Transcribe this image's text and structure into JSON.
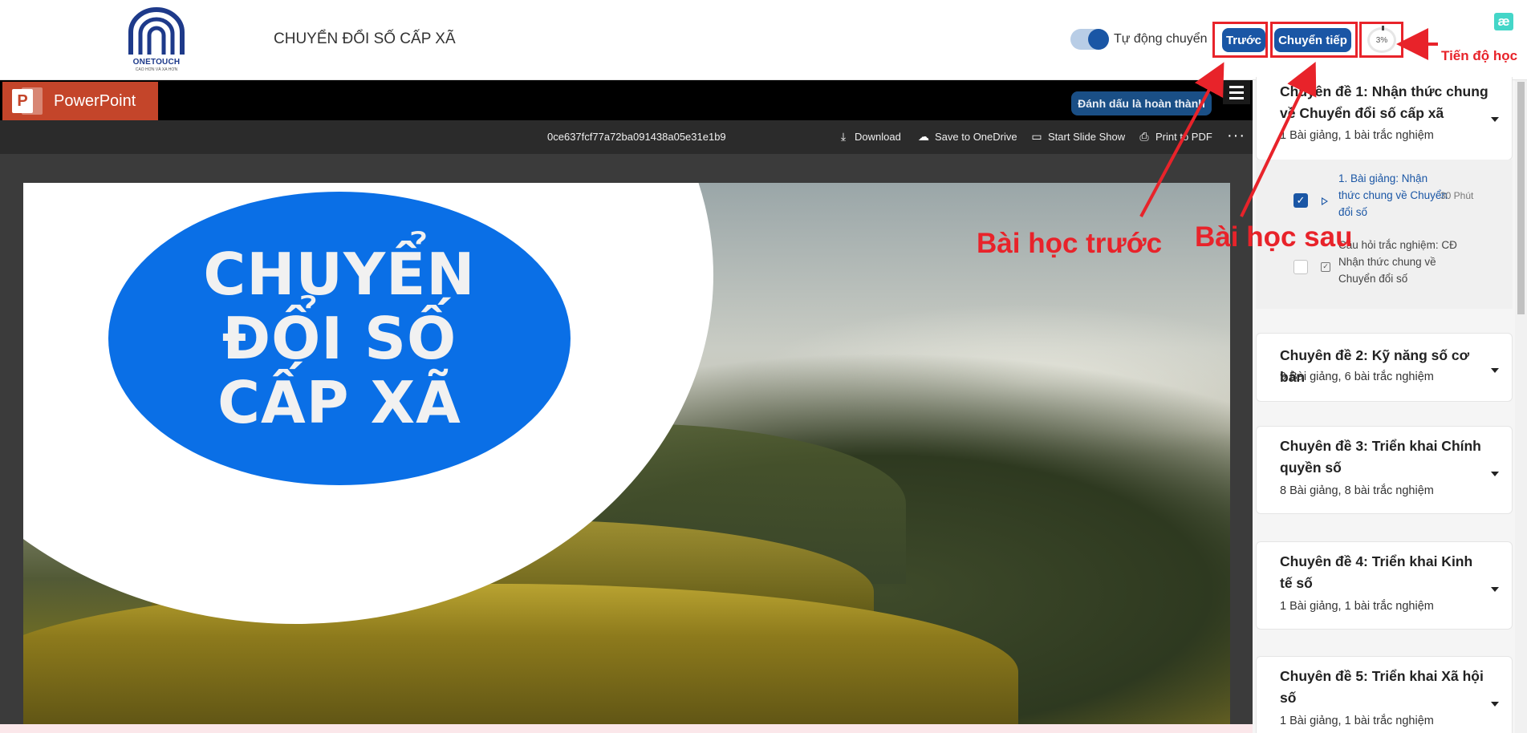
{
  "header": {
    "logo_brand": "ONETOUCH",
    "logo_tagline": "CAO HƠN VÀ XA HƠN",
    "course_title": "CHUYỂN ĐỔI SỐ CẤP XÃ",
    "auto_switch_label": "Tự động chuyển",
    "auto_switch_on": true,
    "prev_button": "Trước",
    "next_button": "Chuyển tiếp",
    "progress_value": "3%",
    "ext_icon": "æ"
  },
  "viewer": {
    "app_name": "PowerPoint",
    "mark_done_button": "Đánh dấu là hoàn thành",
    "file_id": "0ce637fcf77a72ba091438a05e31e1b9",
    "toolbar": {
      "download": "Download",
      "save_onedrive": "Save to OneDrive",
      "start_slideshow": "Start Slide Show",
      "print_pdf": "Print to PDF",
      "more": "···"
    },
    "slide_title": "CHUYỂN ĐỔI SỐ CẤP XÃ"
  },
  "sidebar": {
    "topics": [
      {
        "title": "Chuyên đề 1: Nhận thức chung về Chuyển đổi số cấp xã",
        "summary": "1 Bài giảng, 1 bài trắc nghiệm",
        "expanded": true
      },
      {
        "title": "Chuyên đề 2: Kỹ năng số cơ bản",
        "summary": "9 Bài giảng, 6 bài trắc nghiệm",
        "expanded": false
      },
      {
        "title": "Chuyên đề 3: Triển khai Chính quyền số",
        "summary": "8 Bài giảng, 8 bài trắc nghiệm",
        "expanded": false
      },
      {
        "title": "Chuyên đề 4: Triển khai Kinh tế số",
        "summary": "1 Bài giảng, 1 bài trắc nghiệm",
        "expanded": false
      },
      {
        "title": "Chuyên đề 5: Triển khai Xã hội số",
        "summary": "1 Bài giảng, 1 bài trắc nghiệm",
        "expanded": false
      }
    ],
    "lessons": [
      {
        "text": "1. Bài giảng: Nhận thức chung về Chuyển đổi số",
        "duration": "30 Phút",
        "checked": true
      },
      {
        "text": "Câu hỏi trắc nghiệm: CĐ Nhận thức chung về Chuyển đổi số",
        "duration": "",
        "checked": false
      }
    ]
  },
  "annotations": {
    "prev_lesson": "Bài học trước",
    "next_lesson": "Bài học sau",
    "progress": "Tiến độ học"
  },
  "colors": {
    "accent": "#1a56a5",
    "annotation": "#e8232a",
    "ppt_brand": "#c4452a",
    "slide_pill": "#0a6fe6"
  }
}
